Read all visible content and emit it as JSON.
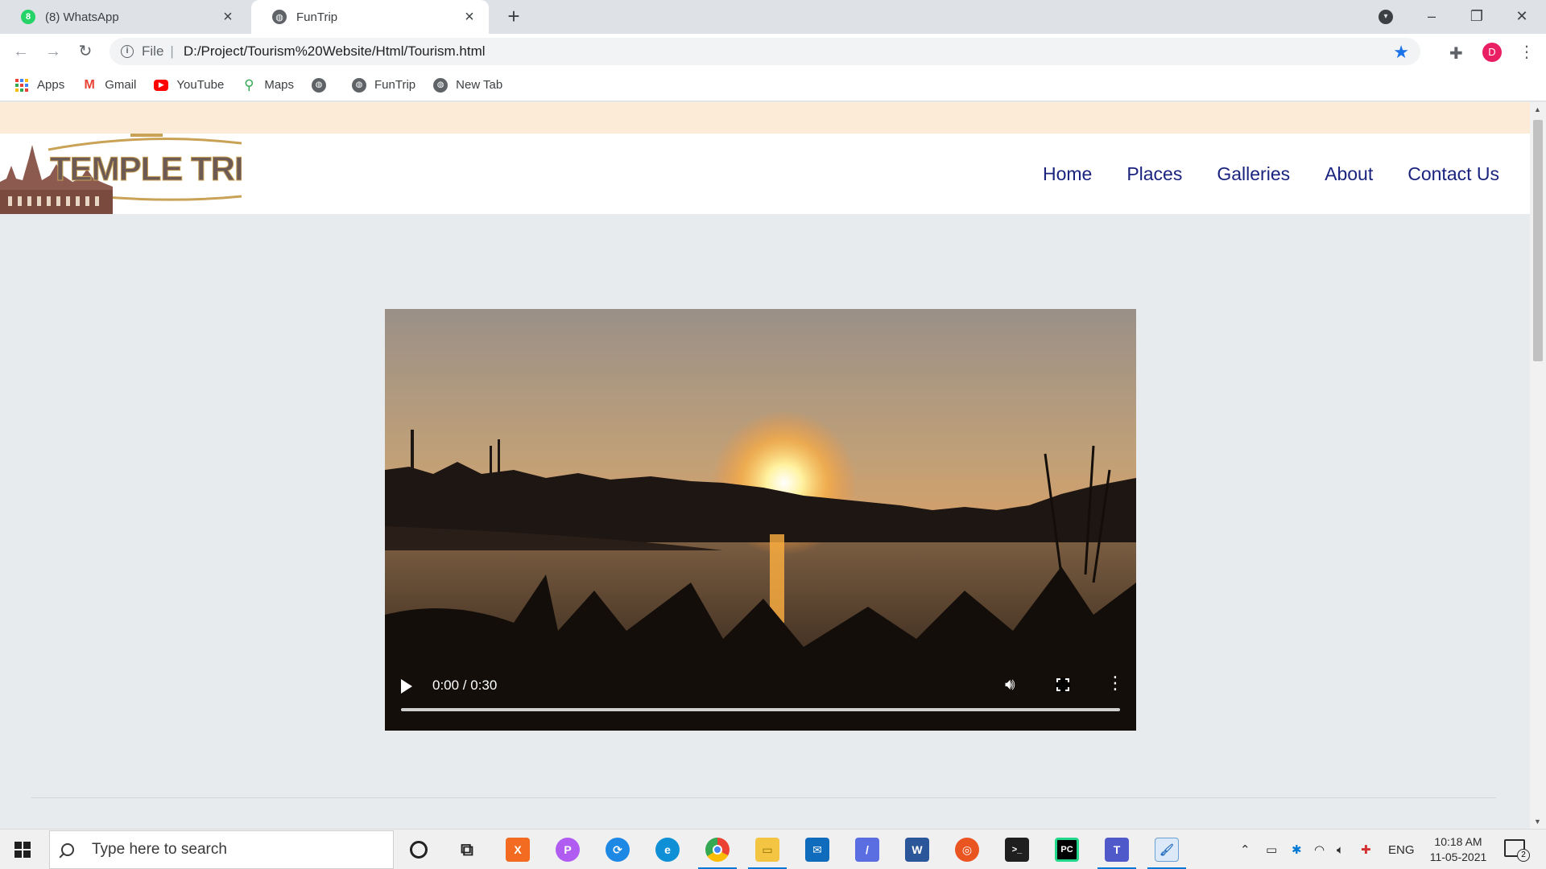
{
  "browser": {
    "tabs": [
      {
        "title": "(8) WhatsApp",
        "badge": "8",
        "icon": "whatsapp-icon",
        "active": false
      },
      {
        "title": "FunTrip",
        "icon": "globe-icon",
        "active": true
      }
    ],
    "address": {
      "scheme": "File",
      "url": "D:/Project/Tourism%20Website/Html/Tourism.html"
    },
    "profile_initial": "D",
    "bookmarks": [
      {
        "label": "Apps",
        "icon": "apps-grid-icon"
      },
      {
        "label": "Gmail",
        "icon": "gmail-icon"
      },
      {
        "label": "YouTube",
        "icon": "youtube-icon"
      },
      {
        "label": "Maps",
        "icon": "maps-icon"
      },
      {
        "label": "",
        "icon": "globe-icon"
      },
      {
        "label": "FunTrip",
        "icon": "globe-icon"
      },
      {
        "label": "New Tab",
        "icon": "globe-icon"
      }
    ]
  },
  "site": {
    "logo_text": "TEMPLE TRIP",
    "nav": [
      "Home",
      "Places",
      "Galleries",
      "About",
      "Contact Us"
    ]
  },
  "video": {
    "time": "0:00 / 0:30",
    "progress": 0
  },
  "taskbar": {
    "search_placeholder": "Type here to search",
    "language": "ENG",
    "time": "10:18 AM",
    "date": "11-05-2021",
    "notification_count": "2"
  },
  "colors": {
    "nav_link": "#1a237e",
    "top_band": "#fbebd7",
    "accent_blue": "#1a73e8"
  }
}
